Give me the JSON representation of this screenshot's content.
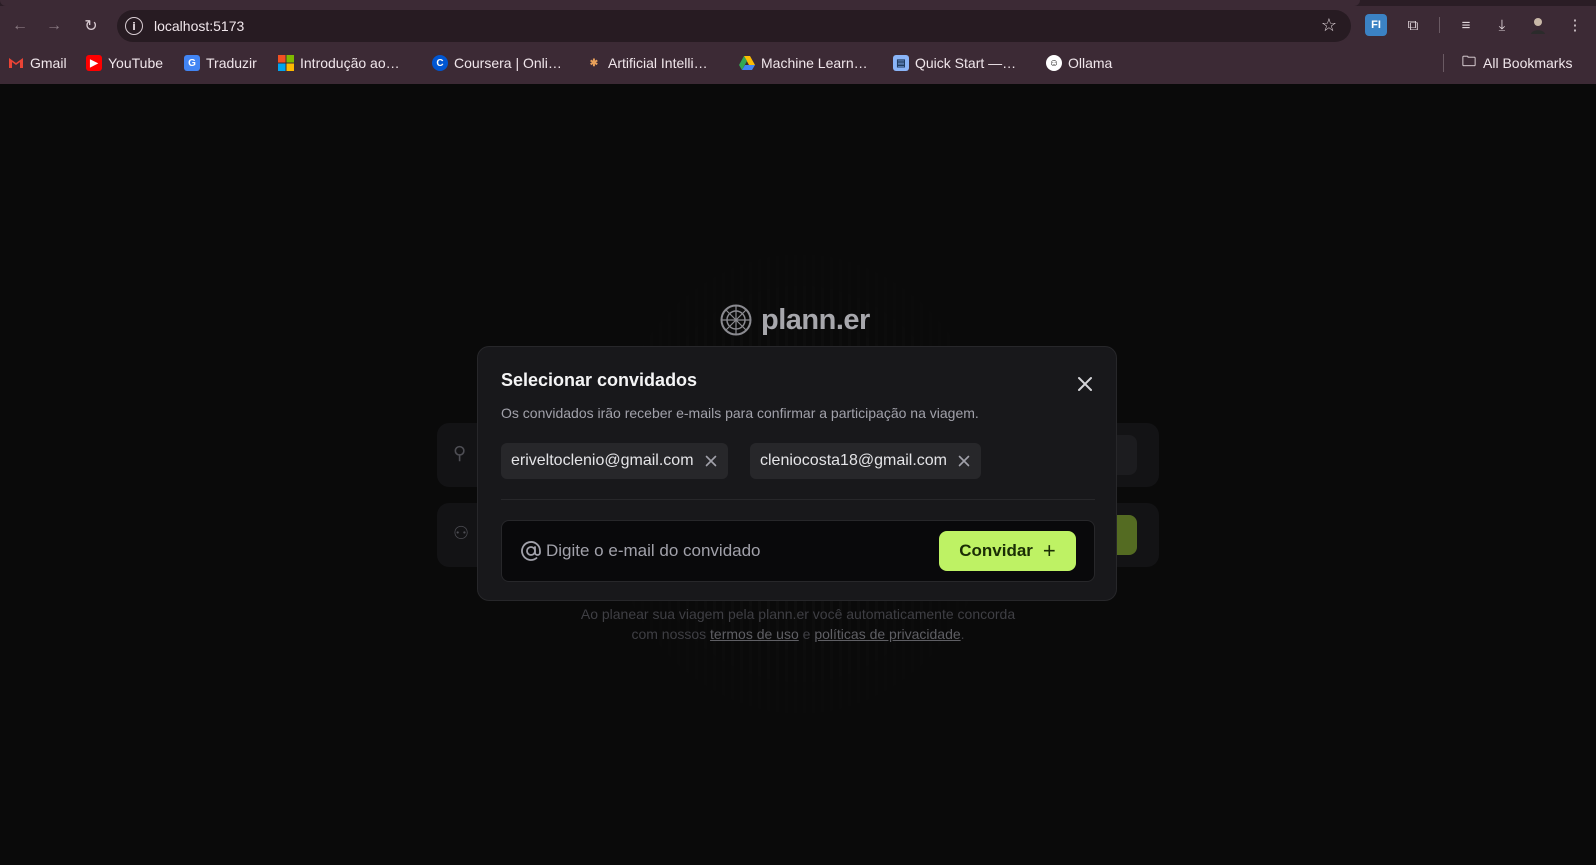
{
  "browser": {
    "url": "localhost:5173",
    "bookmarks": [
      {
        "label": "Gmail",
        "icon": "gmail-icon"
      },
      {
        "label": "YouTube",
        "icon": "youtube-icon"
      },
      {
        "label": "Traduzir",
        "icon": "translate-icon"
      },
      {
        "label": "Introdução ao…",
        "icon": "microsoft-icon"
      },
      {
        "label": "Coursera | Onli…",
        "icon": "coursera-icon"
      },
      {
        "label": "Artificial Intelli…",
        "icon": "ai-icon"
      },
      {
        "label": "Machine Learn…",
        "icon": "drive-icon"
      },
      {
        "label": "Quick Start —…",
        "icon": "docs-icon"
      },
      {
        "label": "Ollama",
        "icon": "ollama-icon"
      }
    ],
    "all_bookmarks": "All Bookmarks",
    "extension_fi": "FI"
  },
  "app": {
    "logo": "plann.er",
    "footer": {
      "line1": "Ao planear sua viagem pela plann.er você automaticamente concorda",
      "line2_prefix": "com nossos",
      "terms": "termos de uso",
      "and": "e",
      "privacy": "políticas de privacidade",
      "end": "."
    }
  },
  "modal": {
    "title": "Selecionar convidados",
    "description": "Os convidados irão receber e-mails para confirmar a participação na viagem.",
    "guests": [
      "eriveltoclenio@gmail.com",
      "cleniocosta18@gmail.com"
    ],
    "input_placeholder": "Digite o e-mail do convidado",
    "invite_label": "Convidar",
    "accent": "#bef264"
  }
}
